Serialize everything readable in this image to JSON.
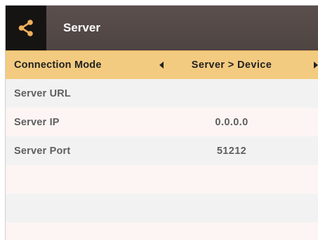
{
  "header": {
    "title": "Server",
    "share_icon": "share-icon"
  },
  "rows": [
    {
      "label": "Connection Mode",
      "value": "Server > Device",
      "selected": true
    },
    {
      "label": "Server URL",
      "value": ""
    },
    {
      "label": "Server IP",
      "value": "0.0.0.0"
    },
    {
      "label": "Server Port",
      "value": "51212"
    },
    {
      "label": "",
      "value": ""
    },
    {
      "label": "",
      "value": ""
    },
    {
      "label": "",
      "value": ""
    }
  ],
  "colors": {
    "header_bg": "#4e4442",
    "selected_row": "#f3cb80",
    "share_button_bg": "#161413",
    "share_icon": "#f2b15c"
  }
}
